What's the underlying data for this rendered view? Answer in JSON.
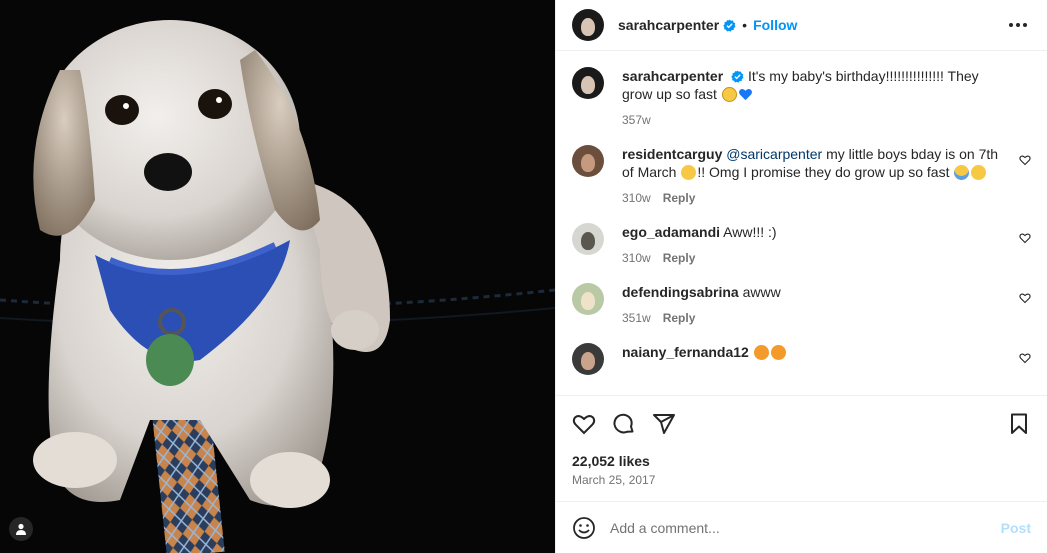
{
  "colors": {
    "accent": "#0095f6",
    "verified": "#0095f6",
    "heart_blue": "#1877f2",
    "mention": "#00376b",
    "post_disabled": "#b2dffc",
    "muted": "#737373"
  },
  "header": {
    "username": "sarahcarpenter",
    "separator": "•",
    "follow_label": "Follow"
  },
  "caption": {
    "username": "sarahcarpenter",
    "text": "It's my baby's birthday!!!!!!!!!!!!!!! They grow up so fast",
    "emojis": [
      "sad-face-emoji",
      "blue-heart-emoji"
    ],
    "time": "357w"
  },
  "comments": [
    {
      "username": "residentcarguy",
      "mention": "@saricarpenter",
      "text": " my little boys bday is on 7th of March",
      "text2": "!! Omg I promise they do grow up so fast",
      "time": "310w",
      "reply_label": "Reply"
    },
    {
      "username": "ego_adamandi",
      "text": "Aww!!! :)",
      "time": "310w",
      "reply_label": "Reply"
    },
    {
      "username": "defendingsabrina",
      "text": "awww",
      "time": "351w",
      "reply_label": "Reply"
    },
    {
      "username": "naiany_fernanda12",
      "text": "",
      "emojis": [
        "tiger-face-emoji",
        "tiger-face-emoji"
      ]
    }
  ],
  "likes": "22,052 likes",
  "date": "March 25, 2017",
  "add_comment": {
    "placeholder": "Add a comment...",
    "post_label": "Post"
  }
}
